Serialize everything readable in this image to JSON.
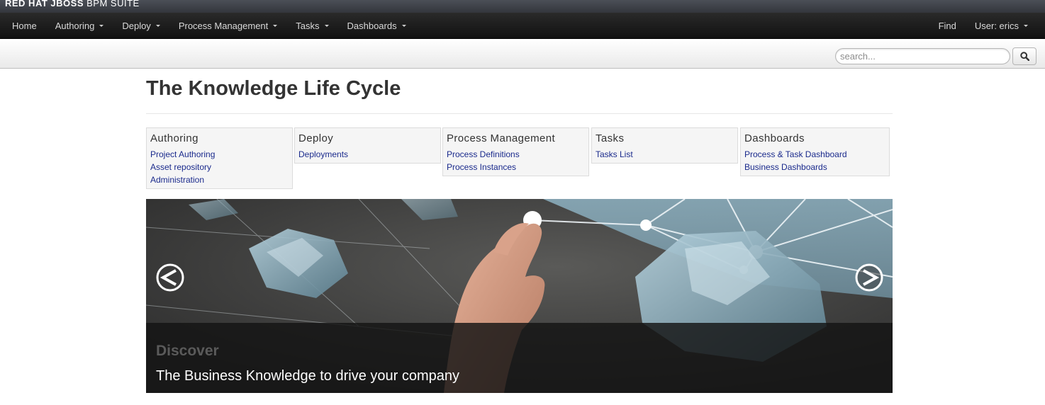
{
  "brand": {
    "part1": "RED HAT JBOSS",
    "part2": "BPM SUITE"
  },
  "nav": {
    "items": [
      {
        "label": "Home"
      },
      {
        "label": "Authoring"
      },
      {
        "label": "Deploy"
      },
      {
        "label": "Process Management"
      },
      {
        "label": "Tasks"
      },
      {
        "label": "Dashboards"
      }
    ],
    "find_label": "Find",
    "user_label": "User: erics"
  },
  "search": {
    "placeholder": "search...",
    "value": "",
    "icon": "search-icon"
  },
  "page": {
    "title": "The Knowledge Life Cycle"
  },
  "boxes": [
    {
      "title": "Authoring",
      "links": [
        "Project Authoring",
        "Asset repository",
        "Administration"
      ]
    },
    {
      "title": "Deploy",
      "links": [
        "Deployments"
      ]
    },
    {
      "title": "Process Management",
      "links": [
        "Process Definitions",
        "Process Instances"
      ]
    },
    {
      "title": "Tasks",
      "links": [
        "Tasks List"
      ]
    },
    {
      "title": "Dashboards",
      "links": [
        "Process & Task Dashboard",
        "Business Dashboards"
      ]
    }
  ],
  "carousel": {
    "caption_title": "Discover",
    "caption_text": "The Business Knowledge to drive your company",
    "prev_icon": "chevron-left-icon",
    "next_icon": "chevron-right-icon"
  },
  "colors": {
    "link": "#1a2a8c",
    "navbar": "#1a1a1a",
    "brandbar": "#3f434a"
  }
}
